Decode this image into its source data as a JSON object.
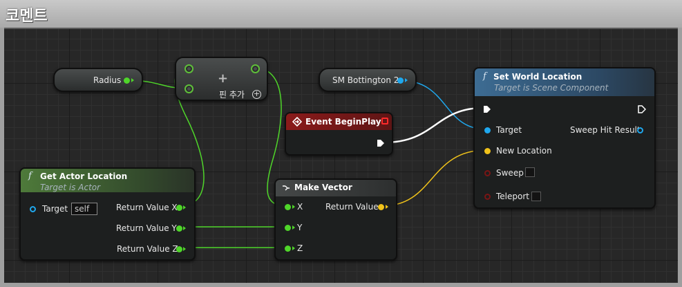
{
  "comment": {
    "title": "코멘트"
  },
  "nodes": {
    "radius": {
      "label": "Radius"
    },
    "add_pin": {
      "plus": "+",
      "label": "핀 추가"
    },
    "sm_bottington": {
      "label": "SM Bottington 2"
    },
    "set_world_location": {
      "title": "Set World Location",
      "subtitle": "Target is Scene Component",
      "inputs": [
        "Target",
        "New Location",
        "Sweep",
        "Teleport"
      ],
      "outputs": [
        "Sweep Hit Result"
      ]
    },
    "event_begin_play": {
      "title": "Event BeginPlay"
    },
    "get_actor_location": {
      "title": "Get Actor Location",
      "subtitle": "Target is Actor",
      "input": "Target",
      "input_value": "self",
      "outputs": [
        "Return Value X",
        "Return Value Y",
        "Return Value Z"
      ]
    },
    "make_vector": {
      "title": "Make Vector",
      "inputs": [
        "X",
        "Y",
        "Z"
      ],
      "output": "Return Value"
    }
  },
  "colors": {
    "float_pin": "#4fd62a",
    "object_pin": "#1fa8ee",
    "vector_pin": "#f0c21a",
    "bool_pin": "#7a1515",
    "exec_wire": "#ffffff"
  }
}
